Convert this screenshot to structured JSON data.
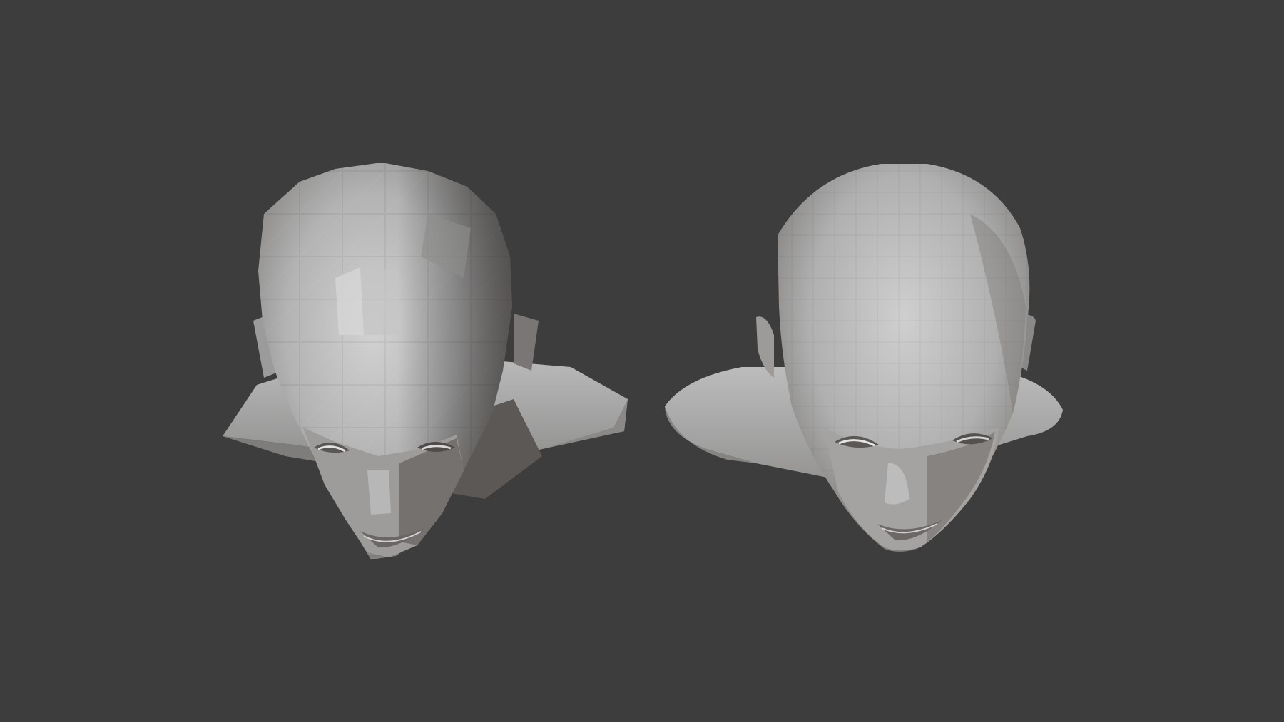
{
  "viewport": {
    "background_color": "#3d3d3d"
  },
  "models": [
    {
      "id": "low-poly-head",
      "shading": "flat",
      "subdivision_level": 0,
      "base_color": "#a9a9a9",
      "highlight_color": "#d0d0d0",
      "shadow_color": "#5f5b58"
    },
    {
      "id": "smoothed-head",
      "shading": "flat",
      "subdivision_level": 1,
      "base_color": "#a9a9a9",
      "highlight_color": "#cdcdcd",
      "shadow_color": "#6a6662"
    }
  ]
}
